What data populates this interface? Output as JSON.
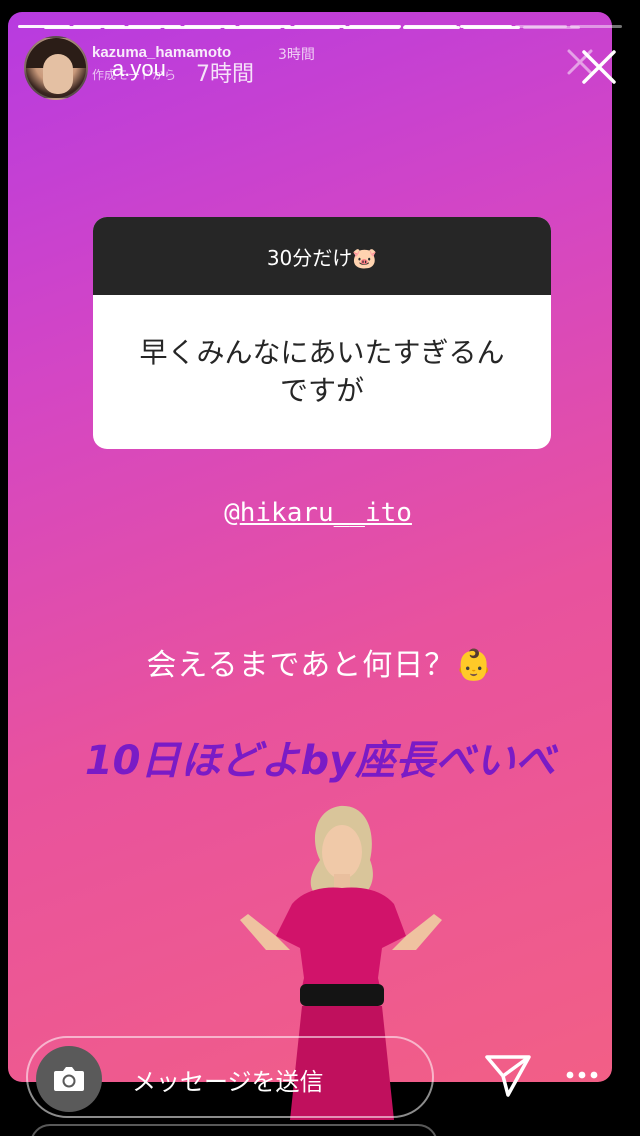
{
  "story": {
    "progress_outer_segments": 11,
    "progress_outer_done": 9,
    "progress_inner_segments": 9,
    "progress_inner_done": 8,
    "inner_user": "kazuma_hamamoto",
    "inner_time": "3時間",
    "inner_sub": "作成モードから",
    "outer_user": "a.you",
    "outer_time": "7時間"
  },
  "question": {
    "header": "30分だけ🐷",
    "body": "早くみんなにあいたすぎるんですが"
  },
  "mention": {
    "at": "@",
    "handle": "hikaru__ito"
  },
  "captions": {
    "white": "会えるまであと何日？👶",
    "purple": "10日ほどよby座長べいべ"
  },
  "bottom_bar": {
    "message_placeholder": "メッセージを送信"
  },
  "icons": {
    "camera": "camera-icon",
    "send": "paper-plane-icon",
    "more": "more-dots-icon",
    "close": "close-icon"
  }
}
